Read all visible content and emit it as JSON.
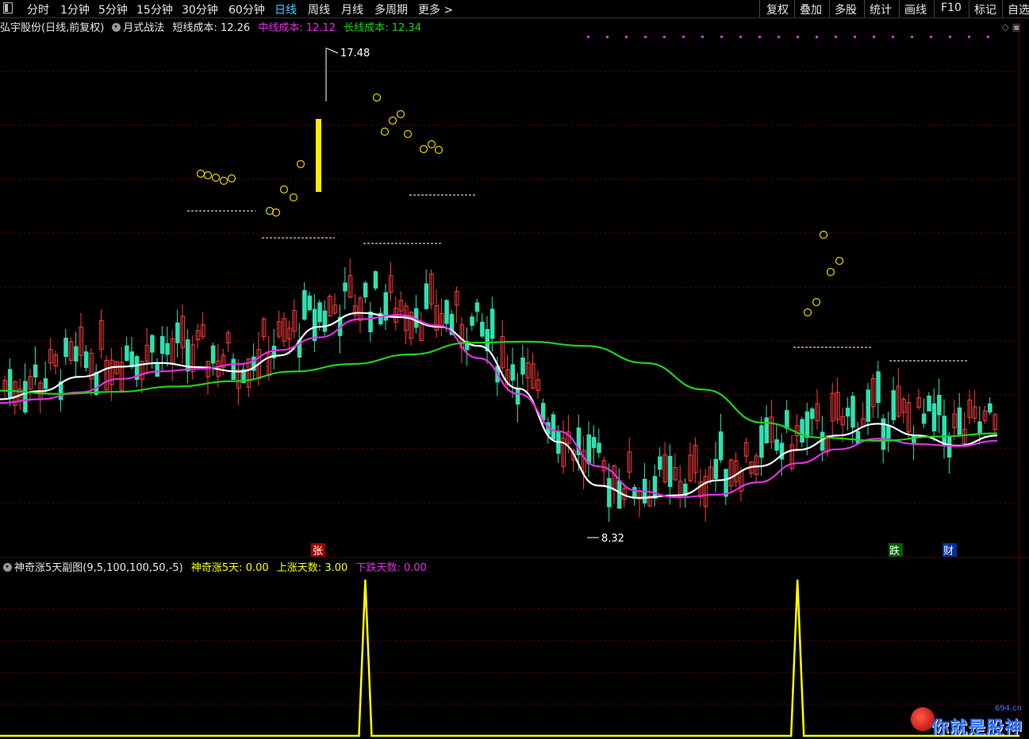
{
  "toolbar": {
    "periods": [
      "分时",
      "1分钟",
      "5分钟",
      "15分钟",
      "30分钟",
      "60分钟",
      "日线",
      "周线",
      "月线",
      "多周期",
      "更多 >"
    ],
    "active": "日线",
    "right_buttons": [
      "复权",
      "叠加",
      "多股",
      "统计",
      "画线",
      "F10",
      "标记",
      "自选"
    ]
  },
  "main_legend": {
    "stock": "弘宇股份(日线,前复权)",
    "indicator": "月式战法",
    "short_label": "短线成本:",
    "short_value": "12.26",
    "mid_label": "中线成本:",
    "mid_value": "12.12",
    "long_label": "长线成本:",
    "long_value": "12.34"
  },
  "sub_legend": {
    "indicator": "神奇涨5天副图(9,5,100,100,50,-5)",
    "up5_label": "神奇涨5天:",
    "up5_value": "0.00",
    "updays_label": "上涨天数:",
    "updays_value": "3.00",
    "downdays_label": "下跌天数:",
    "downdays_value": "0.00"
  },
  "markers": {
    "high_label": "17.48",
    "low_label": "8.32",
    "tag_up": "张",
    "tag_down": "跌",
    "tag_fin": "财"
  },
  "colors": {
    "up": "#ff3b3b",
    "down": "#2fe0b0",
    "short_line": "#ffffff",
    "mid_line": "#e030e0",
    "long_line": "#20d020",
    "indicator_line": "#ffff00",
    "grid": "#7a0000",
    "toolbar_active": "#3fd0ff"
  },
  "logo": {
    "text": "你就是股神",
    "url_text": "694.cn"
  },
  "chart_data": {
    "type": "line",
    "title": "",
    "price_range": [
      8.32,
      17.48
    ],
    "series": [
      {
        "name": "短线成本",
        "values": [
          10.9,
          11.05,
          11.32,
          11.51,
          11.58,
          11.5,
          11.42,
          11.72,
          12.26,
          12.52,
          12.44,
          12.26,
          11.9,
          11.1,
          10.1,
          9.28,
          9.05,
          9.1,
          9.38,
          9.64,
          9.95,
          10.22,
          10.44,
          10.22,
          10.03,
          10.22
        ]
      },
      {
        "name": "中线成本",
        "values": [
          10.83,
          10.9,
          11.03,
          11.28,
          11.42,
          11.47,
          11.56,
          11.82,
          12.06,
          12.4,
          12.48,
          12.28,
          11.67,
          11.0,
          10.3,
          9.64,
          9.18,
          9.06,
          9.11,
          9.34,
          9.7,
          9.96,
          10.16,
          10.06,
          10.02,
          10.12
        ]
      },
      {
        "name": "长线成本",
        "values": [
          11.06,
          11.0,
          11.04,
          11.14,
          11.24,
          11.42,
          11.56,
          11.74,
          11.96,
          11.98,
          11.9,
          11.58,
          11.08,
          10.46,
          10.18,
          10.12,
          10.2,
          10.26
        ]
      }
    ],
    "indicator": {
      "name": "神奇涨5天",
      "spikes": [
        {
          "day_fraction": 0.355,
          "value": 100
        },
        {
          "day_fraction": 0.775,
          "value": 100
        }
      ],
      "baseline": 0
    }
  }
}
